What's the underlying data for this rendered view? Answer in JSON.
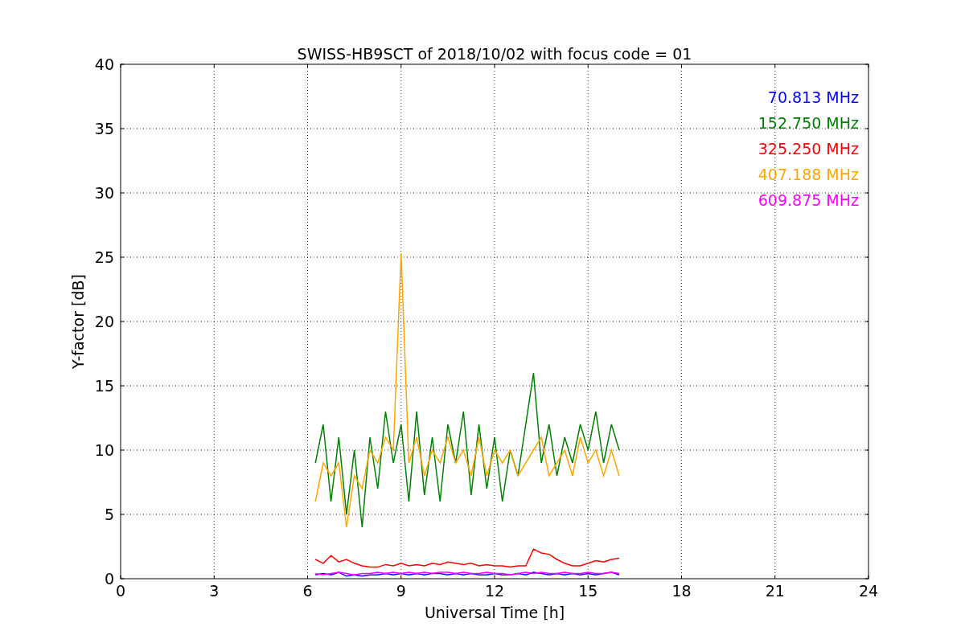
{
  "figure": {
    "chart_data": {
      "type": "line",
      "title": "SWISS-HB9SCT of 2018/10/02 with focus code = 01",
      "xlabel": "Universal Time [h]",
      "ylabel": "Y-factor [dB]",
      "x": [
        6.25,
        6.5,
        6.75,
        7,
        7.25,
        7.5,
        7.75,
        8,
        8.25,
        8.5,
        8.75,
        9,
        9.25,
        9.5,
        9.75,
        10,
        10.25,
        10.5,
        10.75,
        11,
        11.25,
        11.5,
        11.75,
        12,
        12.25,
        12.5,
        12.75,
        13,
        13.25,
        13.5,
        13.75,
        14,
        14.25,
        14.5,
        14.75,
        15,
        15.25,
        15.5,
        15.75,
        16
      ],
      "grid": true,
      "xlim": [
        0,
        24
      ],
      "ylim": [
        0,
        40
      ],
      "xticks": [
        0,
        3,
        6,
        9,
        12,
        15,
        18,
        21,
        24
      ],
      "yticks": [
        0,
        5,
        10,
        15,
        20,
        25,
        30,
        35,
        40
      ],
      "series": [
        {
          "name": "70.813 MHz",
          "color": "#0000ff",
          "values": [
            0.3,
            0.4,
            0.3,
            0.5,
            0.2,
            0.3,
            0.2,
            0.3,
            0.3,
            0.4,
            0.3,
            0.4,
            0.3,
            0.4,
            0.3,
            0.4,
            0.4,
            0.3,
            0.4,
            0.3,
            0.4,
            0.3,
            0.3,
            0.4,
            0.3,
            0.3,
            0.4,
            0.3,
            0.5,
            0.4,
            0.3,
            0.4,
            0.3,
            0.4,
            0.3,
            0.4,
            0.3,
            0.4,
            0.5,
            0.3
          ]
        },
        {
          "name": "152.750 MHz",
          "color": "#008000",
          "values": [
            9,
            12,
            6,
            11,
            5,
            10,
            4,
            11,
            7,
            13,
            9,
            12,
            6,
            13,
            6.5,
            11,
            6,
            12,
            9,
            13,
            6.5,
            12,
            7,
            11,
            6,
            10,
            8,
            12,
            16,
            9,
            12,
            8,
            11,
            9,
            12,
            10,
            13,
            9,
            12,
            10
          ]
        },
        {
          "name": "325.250 MHz",
          "color": "#ff0000",
          "values": [
            1.5,
            1.2,
            1.8,
            1.3,
            1.5,
            1.2,
            1.0,
            0.9,
            0.9,
            1.1,
            1.0,
            1.2,
            1.0,
            1.1,
            1.0,
            1.2,
            1.1,
            1.3,
            1.2,
            1.1,
            1.2,
            1.0,
            1.1,
            1.0,
            1.0,
            0.9,
            1.0,
            1.0,
            2.3,
            2.0,
            1.9,
            1.5,
            1.2,
            1.0,
            1.0,
            1.2,
            1.4,
            1.3,
            1.5,
            1.6
          ]
        },
        {
          "name": "407.188 MHz",
          "color": "#ffa500",
          "values": [
            6,
            9,
            8,
            9,
            4,
            8,
            7,
            10,
            9,
            11,
            10,
            25.3,
            9,
            11,
            8,
            10,
            9,
            11,
            9,
            10,
            8,
            11,
            8,
            10,
            9,
            10,
            8,
            9,
            10,
            11,
            8,
            9,
            10,
            8,
            11,
            9,
            10,
            8,
            10,
            8
          ]
        },
        {
          "name": "609.875 MHz",
          "color": "#ff00ff",
          "values": [
            0.4,
            0.3,
            0.4,
            0.5,
            0.4,
            0.3,
            0.4,
            0.4,
            0.5,
            0.4,
            0.5,
            0.4,
            0.5,
            0.4,
            0.5,
            0.4,
            0.5,
            0.5,
            0.4,
            0.5,
            0.4,
            0.4,
            0.5,
            0.4,
            0.4,
            0.3,
            0.4,
            0.5,
            0.4,
            0.5,
            0.4,
            0.4,
            0.5,
            0.4,
            0.4,
            0.5,
            0.4,
            0.4,
            0.5,
            0.4
          ]
        }
      ]
    }
  }
}
